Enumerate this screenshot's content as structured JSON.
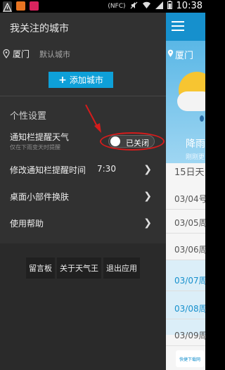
{
  "status_bar": {
    "time": "10:38",
    "nfc": "(NFC)",
    "icons": [
      "alert-icon",
      "app-icon",
      "app-icon-2",
      "nfc-icon",
      "mute-icon",
      "wifi-icon",
      "signal-icon",
      "battery-icon"
    ]
  },
  "drawer": {
    "title": "我关注的城市",
    "city": {
      "name": "厦门",
      "default_label": "默认城市"
    },
    "add_city_label": "添加城市",
    "section_title": "个性设置",
    "notify": {
      "title": "通知栏提醒天气",
      "subtitle": "仅在下雨变天时提醒",
      "toggle_label": "已关闭",
      "toggle_state": "off"
    },
    "menu": [
      {
        "label": "修改通知栏提醒时间",
        "value": "7:30"
      },
      {
        "label": "桌面小部件换肤",
        "value": ""
      },
      {
        "label": "使用帮助",
        "value": ""
      }
    ],
    "bottom_buttons": [
      "留言板",
      "关于天气王",
      "退出应用"
    ]
  },
  "main": {
    "city": "厦门",
    "weather_desc": "降雨",
    "weather_sub": "刚刚更",
    "forecast_title": "15日天",
    "days": [
      {
        "label": "03/04号",
        "highlight": false
      },
      {
        "label": "03/05周",
        "highlight": false
      },
      {
        "label": "03/06周",
        "highlight": false
      },
      {
        "label": "03/07周",
        "highlight": true
      },
      {
        "label": "03/08周",
        "highlight": true
      },
      {
        "label": "03/09周",
        "highlight": false
      }
    ],
    "watermark": "快捷下载网"
  },
  "colors": {
    "drawer_bg": "#313131",
    "accent": "#0ea0d8",
    "annotation_red": "#d41c1c",
    "main_header": "#1690cd"
  }
}
